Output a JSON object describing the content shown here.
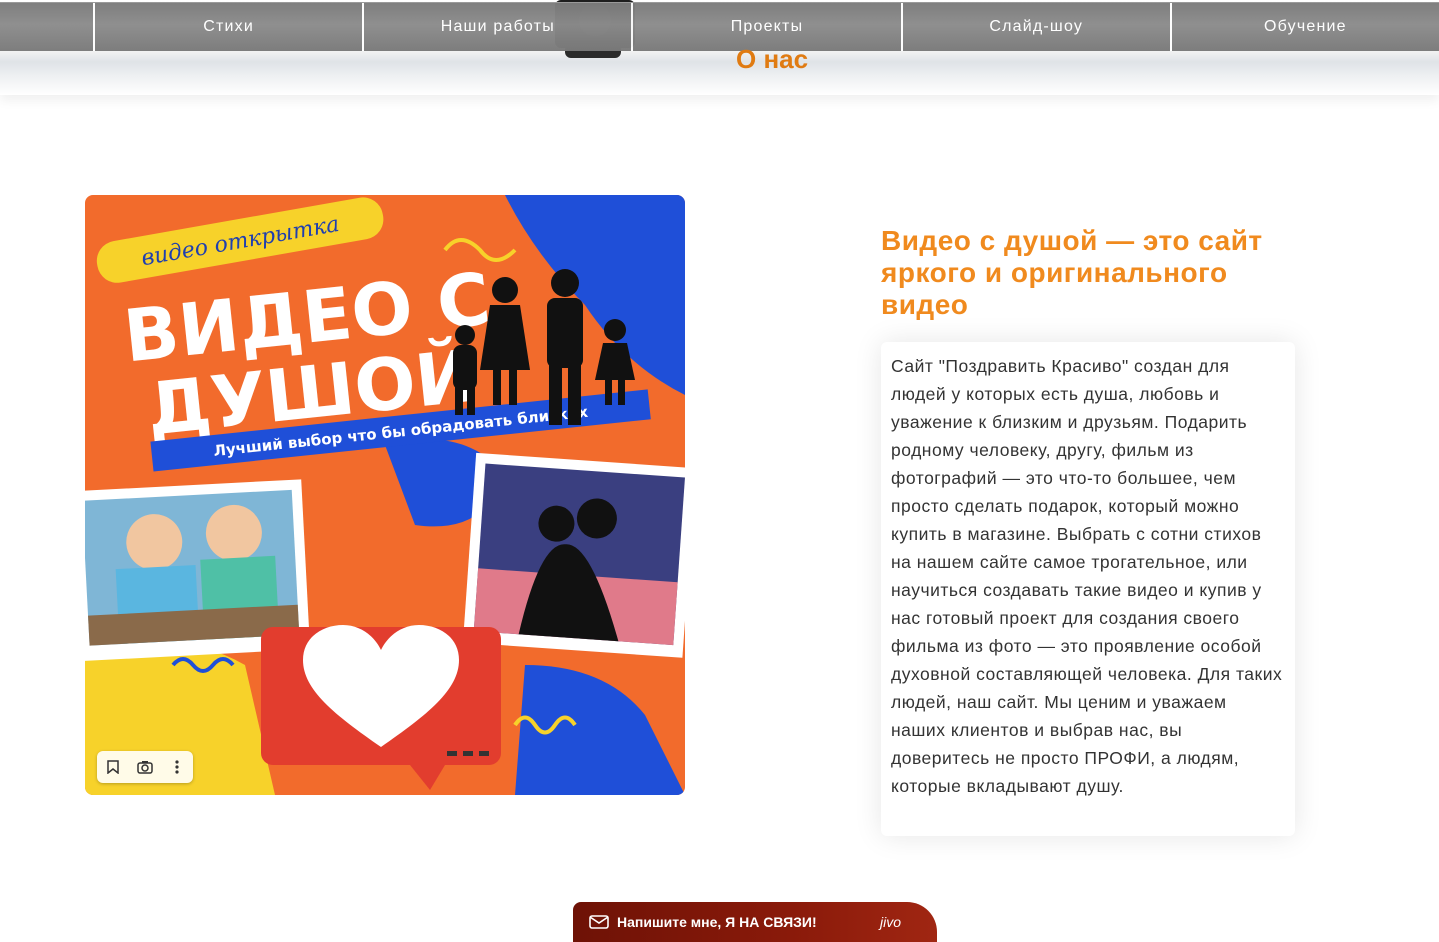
{
  "nav": {
    "items": [
      "Стихи",
      "Наши работы",
      "Проекты",
      "Слайд-шоу",
      "Обучение"
    ],
    "about_link": "О нас"
  },
  "promo_image": {
    "tag_text": "видео открытка",
    "title_line1": "ВИДЕО С",
    "title_line2": "ДУШОЙ",
    "subtitle": "Лучший выбор что бы обрадовать близких",
    "toolbar_icons": [
      "bookmark-icon",
      "camera-lens-icon",
      "more-vertical-icon"
    ]
  },
  "about": {
    "heading": "Видео с душой — это сайт яркого и оригинального видео",
    "body": "Сайт \"Поздравить Красиво\" создан для людей у которых есть душа, любовь и уважение к близким и друзьям. Подарить родному человеку, другу, фильм из фотографий — это что-то большее, чем просто сделать подарок, который можно купить в магазине. Выбрать с сотни стихов на нашем сайте самое трогательное, или научиться создавать такие видео и купив у нас готовый проект для создания своего фильма из фото — это проявление особой духовной составляющей человека. Для таких людей, наш сайт. Мы ценим и уважаем наших клиентов и выбрав нас, вы доверитесь не просто ПРОФИ, а людям, которые вкладывают душу."
  },
  "chat_widget": {
    "label": "Напишите мне, Я НА СВЯЗИ!",
    "brand": "jivo"
  },
  "colors": {
    "accent_orange": "#f08a1e",
    "nav_gray": "#808080",
    "promo_orange": "#f26b2c",
    "promo_blue": "#1f4fd8",
    "promo_yellow": "#f7d22a",
    "heart_red": "#e23d2e",
    "chat_dark_red": "#7a1508"
  }
}
